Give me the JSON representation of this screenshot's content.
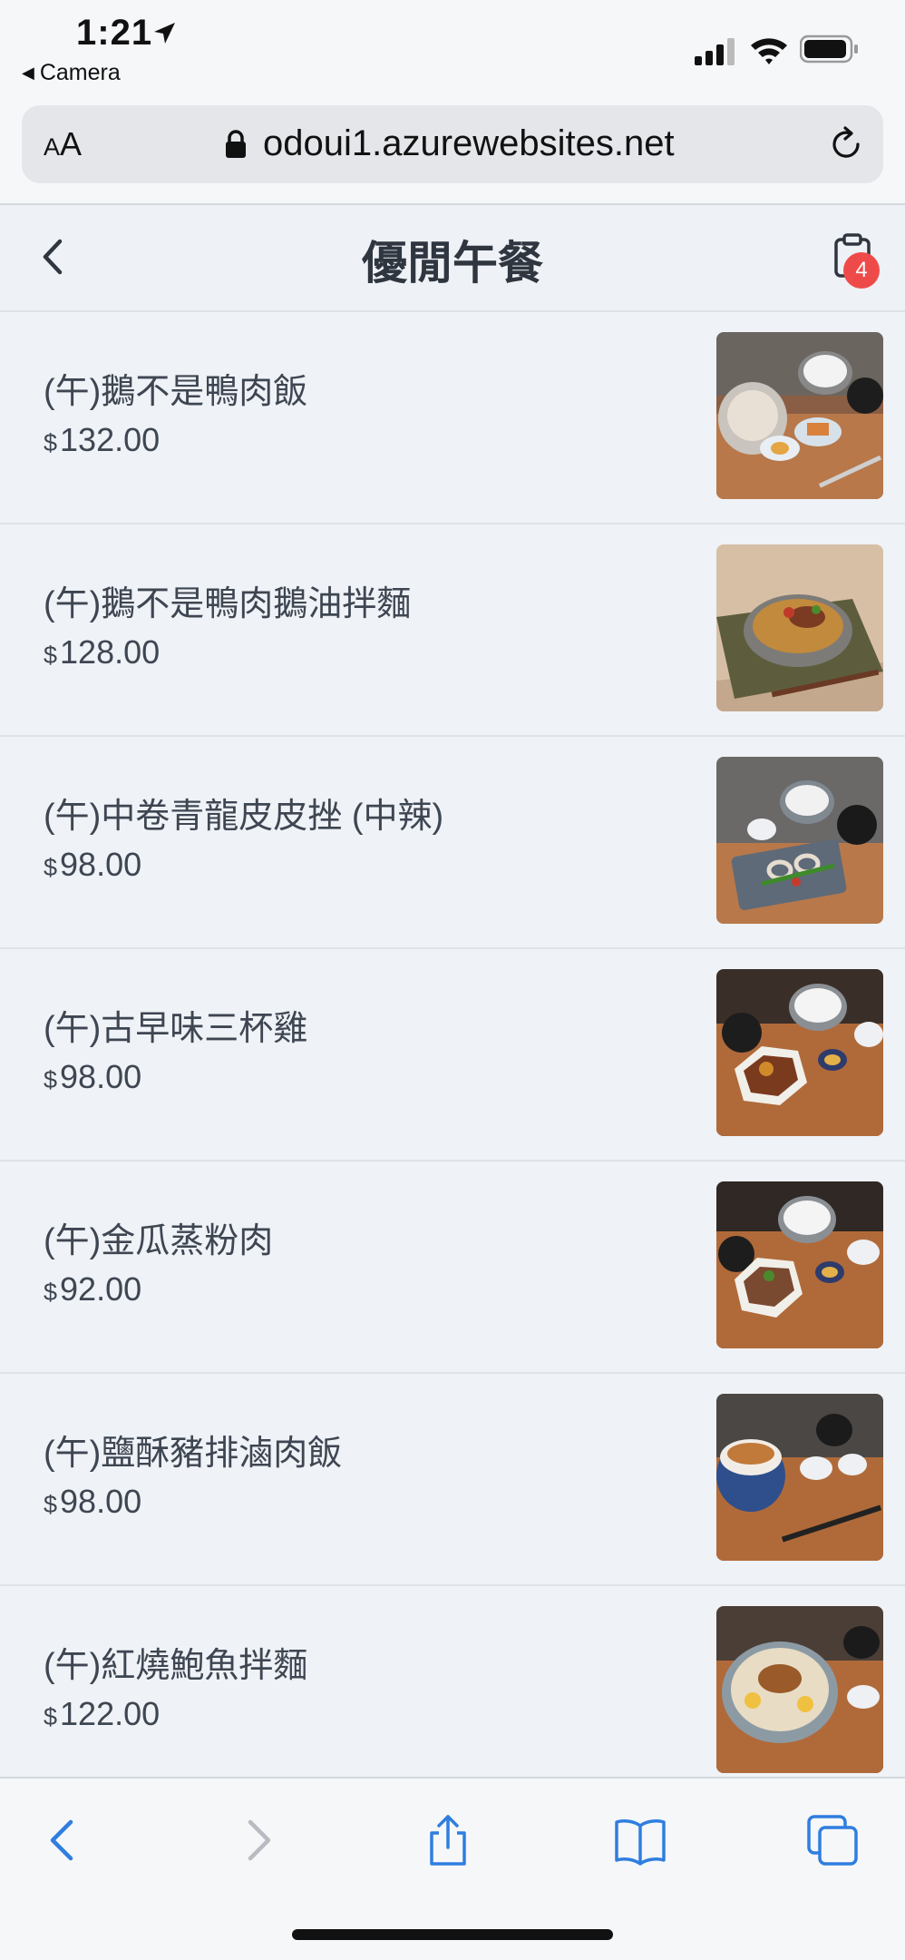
{
  "status_bar": {
    "time": "1:21",
    "back_app": "Camera"
  },
  "browser": {
    "text_size_label_small": "A",
    "text_size_label": "A",
    "url": "odoui1.azurewebsites.net"
  },
  "header": {
    "title": "優閒午餐",
    "cart_count": "4"
  },
  "menu": {
    "currency_symbol": "$",
    "items": [
      {
        "name": "(午)鵝不是鴨肉飯",
        "price": "132.00"
      },
      {
        "name": "(午)鵝不是鴨肉鵝油拌麵",
        "price": "128.00"
      },
      {
        "name": "(午)中卷青龍皮皮挫 (中辣)",
        "price": "98.00"
      },
      {
        "name": "(午)古早味三杯雞",
        "price": "98.00"
      },
      {
        "name": "(午)金瓜蒸粉肉",
        "price": "92.00"
      },
      {
        "name": "(午)鹽酥豬排滷肉飯",
        "price": "98.00"
      },
      {
        "name": "(午)紅燒鮑魚拌麵",
        "price": "122.00"
      }
    ]
  },
  "colors": {
    "accent": "#2f7ee0",
    "badge": "#ef4a4a",
    "background": "#eff2f6"
  },
  "icons": [
    "location-arrow-icon",
    "signal-icon",
    "wifi-icon",
    "battery-icon",
    "lock-icon",
    "reload-icon",
    "chevron-left-icon",
    "clipboard-cart-icon",
    "back-icon",
    "forward-icon",
    "share-icon",
    "bookmarks-icon",
    "tabs-icon"
  ]
}
